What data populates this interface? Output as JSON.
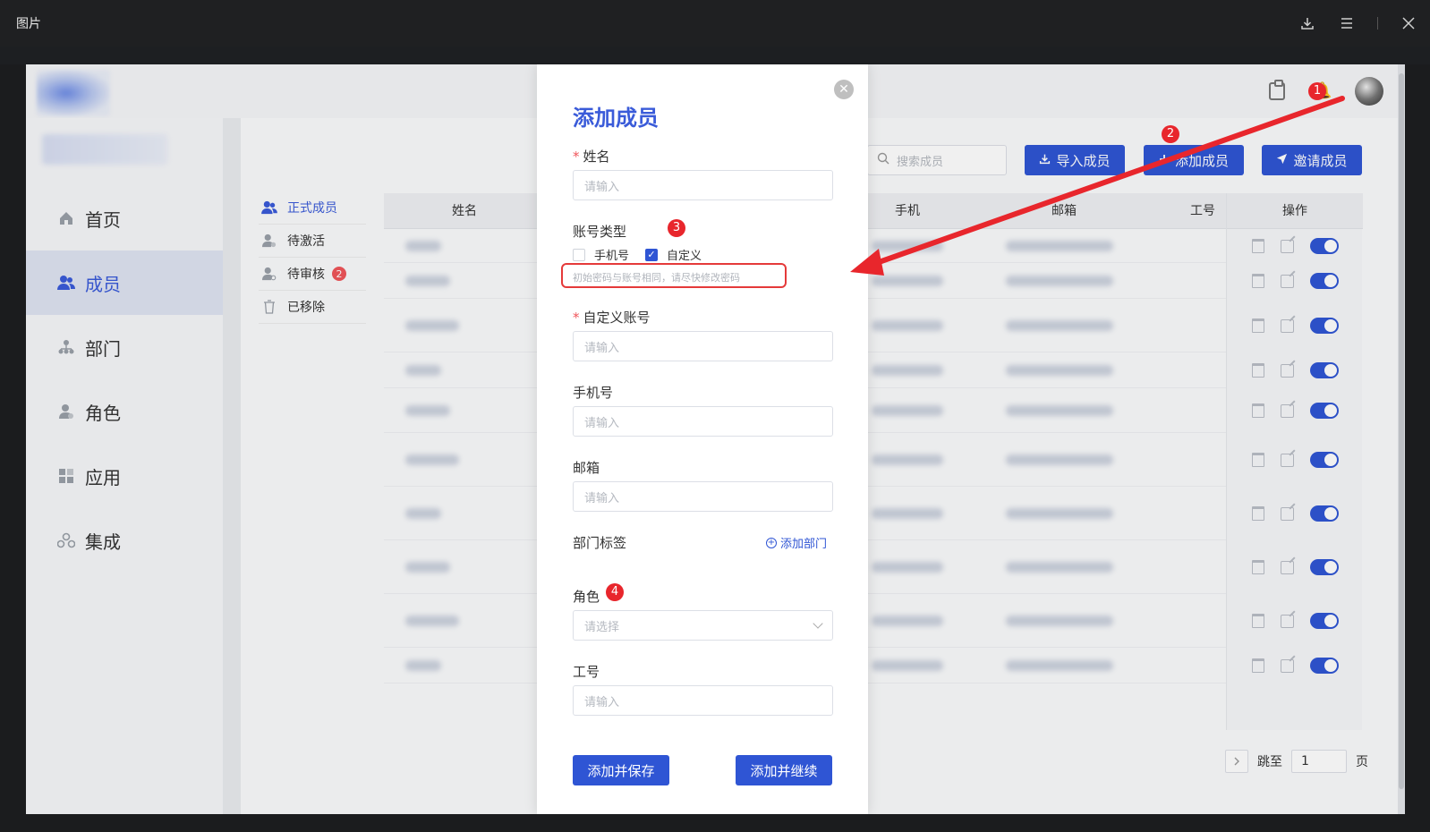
{
  "viewer": {
    "title": "图片"
  },
  "sidebar": {
    "items": [
      {
        "label": "首页",
        "icon": "home-icon"
      },
      {
        "label": "成员",
        "icon": "users-icon",
        "active": true
      },
      {
        "label": "部门",
        "icon": "org-chart-icon"
      },
      {
        "label": "角色",
        "icon": "role-icon"
      },
      {
        "label": "应用",
        "icon": "apps-grid-icon"
      },
      {
        "label": "集成",
        "icon": "integration-icon"
      }
    ]
  },
  "subnav": {
    "items": [
      {
        "label": "正式成员",
        "active": true
      },
      {
        "label": "待激活"
      },
      {
        "label": "待审核",
        "badge": "2"
      },
      {
        "label": "已移除"
      }
    ]
  },
  "toolbar": {
    "search_placeholder": "搜索成员",
    "import_label": "导入成员",
    "add_label": "添加成员",
    "invite_label": "邀请成员"
  },
  "table": {
    "columns": [
      "姓名",
      "手机",
      "邮箱",
      "工号",
      "操作"
    ],
    "row_count": 10
  },
  "pagination": {
    "jump_label": "跳至",
    "page_value": "1",
    "page_unit": "页"
  },
  "modal": {
    "title": "添加成员",
    "name_label": "姓名",
    "account_type_label": "账号类型",
    "option_phone": "手机号",
    "option_custom": "自定义",
    "hint": "初始密码与账号相同，请尽快修改密码",
    "custom_account_label": "自定义账号",
    "phone_label": "手机号",
    "email_label": "邮箱",
    "dept_tag_label": "部门标签",
    "add_dept_label": "添加部门",
    "role_label": "角色",
    "employee_id_label": "工号",
    "input_placeholder": "请输入",
    "select_placeholder": "请选择",
    "save_button": "添加并保存",
    "continue_button": "添加并继续"
  },
  "annotations": {
    "n1": "1",
    "n2": "2",
    "n3": "3",
    "n4": "4",
    "accent": "#e8262c"
  },
  "colors": {
    "primary": "#2f55d4",
    "title_blue": "#3a5bd9"
  }
}
